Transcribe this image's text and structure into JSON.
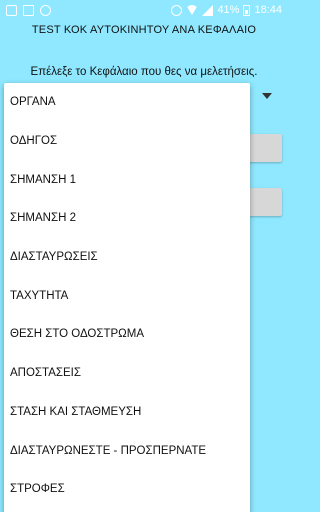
{
  "status_bar": {
    "battery": "41%",
    "time": "18:44",
    "icons": [
      "gallery-icon",
      "notification-icon",
      "shield-icon",
      "alarm-icon",
      "wifi-icon",
      "signal-icon",
      "battery-icon"
    ]
  },
  "app": {
    "title": "TEST ΚΟΚ ΑΥΤΟΚΙΝΗΤΟΥ ΑΝΑ ΚΕΦΑΛΑΙΟ",
    "prompt": "Επέλεξε το Κεφάλαιο που θες να μελετήσεις."
  },
  "dropdown": {
    "items": [
      "ΟΡΓΑΝΑ",
      "ΟΔΗΓΟΣ",
      "ΣΗΜΑΝΣΗ 1",
      "ΣΗΜΑΝΣΗ 2",
      "ΔΙΑΣΤΑΥΡΩΣΕΙΣ",
      "ΤΑΧΥΤΗΤΑ",
      "ΘΕΣΗ ΣΤΟ ΟΔΟΣΤΡΩΜΑ",
      "ΑΠΟΣΤΑΣΕΙΣ",
      "ΣΤΑΣΗ ΚΑΙ ΣΤΑΘΜΕΥΣΗ",
      "ΔΙΑΣΤΑΥΡΩΝΕΣΤΕ - ΠΡΟΣΠΕΡΝΑΤΕ",
      "ΣΤΡΟΦΕΣ"
    ]
  },
  "colors": {
    "background": "#8fe8ff",
    "dropdown": "#ffffff",
    "button": "#d7d7d7"
  }
}
